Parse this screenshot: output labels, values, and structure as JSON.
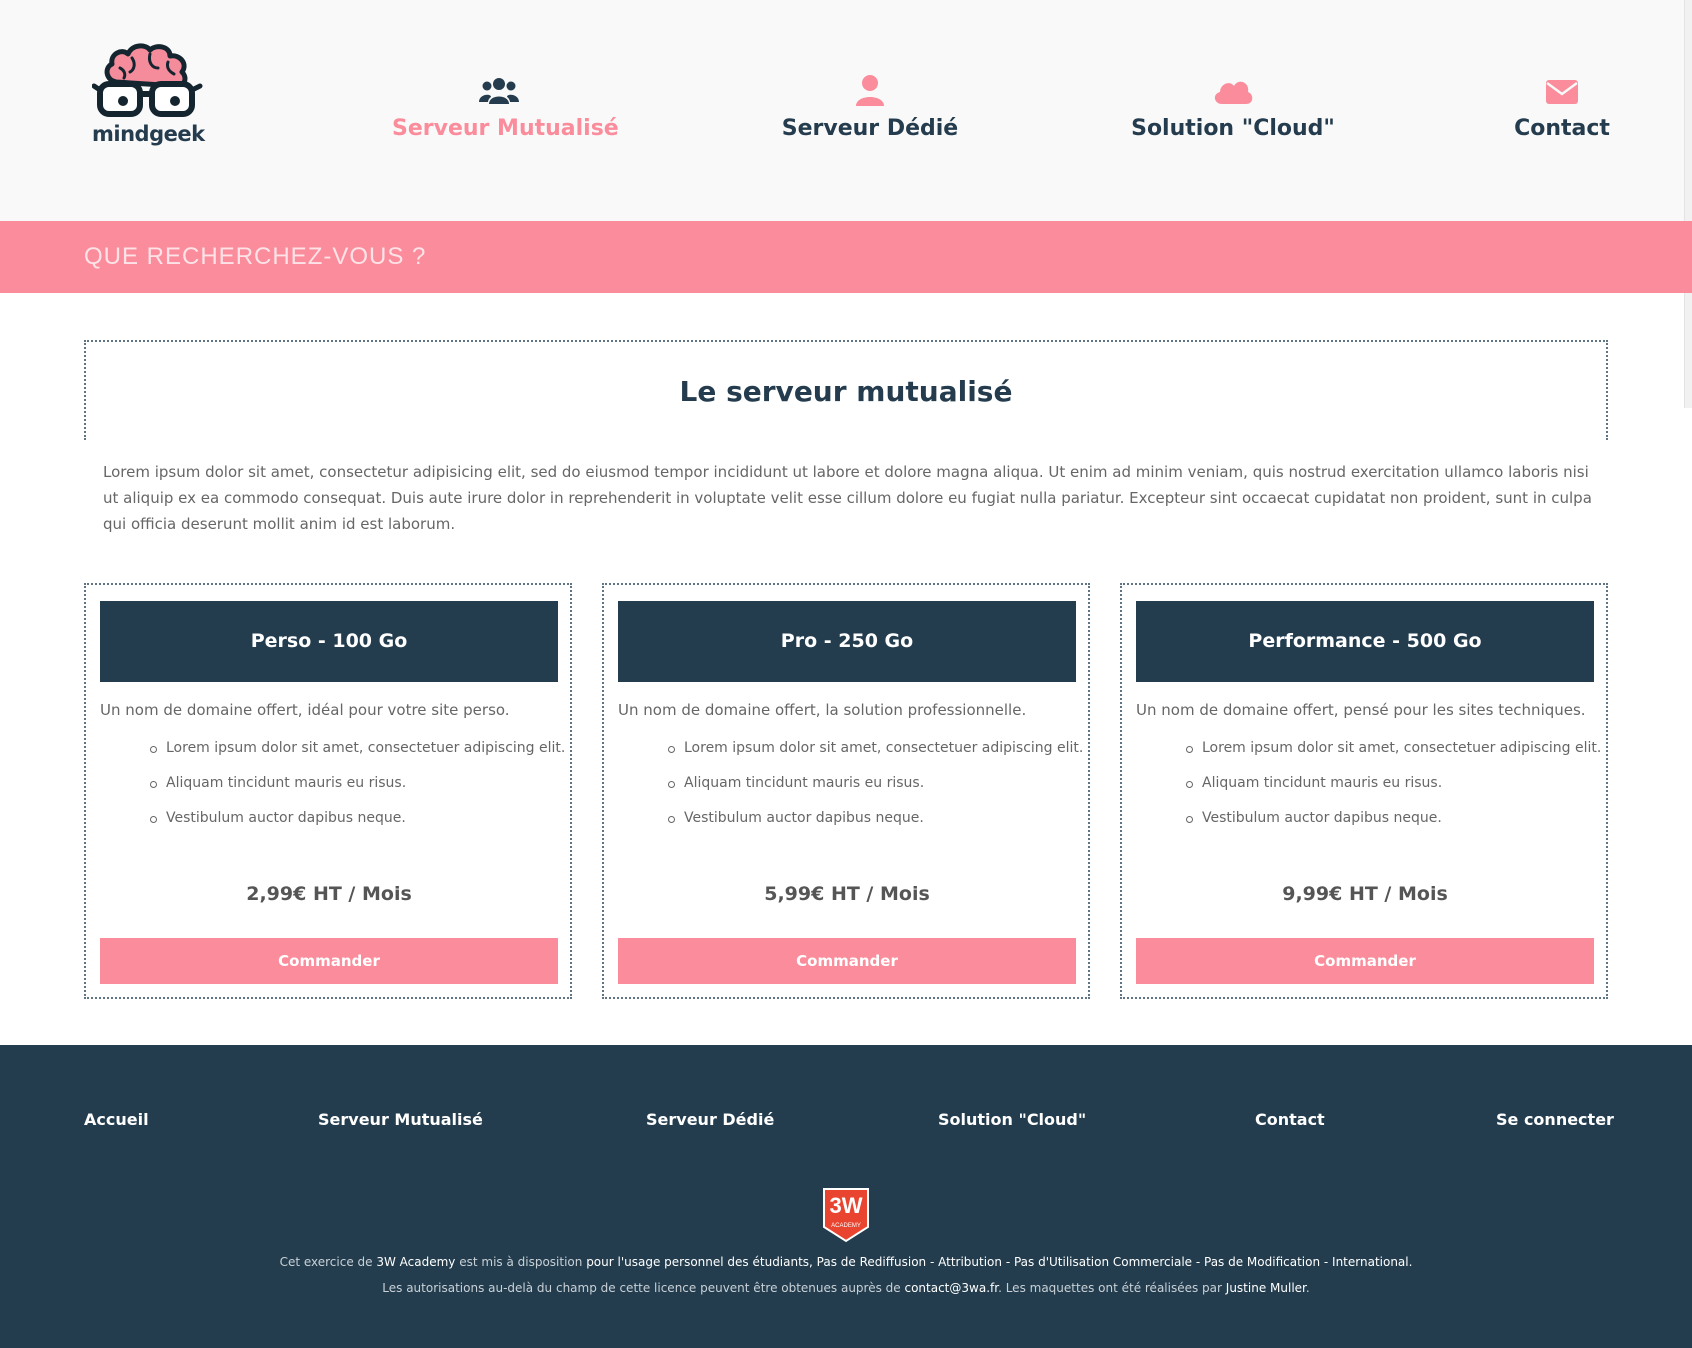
{
  "header": {
    "logo_text": "mindgeek",
    "nav": [
      {
        "label": "Serveur Mutualisé",
        "icon": "users-icon",
        "active": true
      },
      {
        "label": "Serveur Dédié",
        "icon": "user-icon",
        "active": false
      },
      {
        "label": "Solution \"Cloud\"",
        "icon": "cloud-icon",
        "active": false
      },
      {
        "label": "Contact",
        "icon": "envelope-icon",
        "active": false
      }
    ]
  },
  "banner": {
    "text": "QUE RECHERCHEZ-VOUS ?"
  },
  "main": {
    "title": "Le serveur mutualisé",
    "intro": "Lorem ipsum dolor sit amet, consectetur adipisicing elit, sed do eiusmod tempor incididunt ut labore et dolore magna aliqua. Ut enim ad minim veniam, quis nostrud exercitation ullamco laboris nisi ut aliquip ex ea commodo consequat. Duis aute irure dolor in reprehenderit in voluptate velit esse cillum dolore eu fugiat nulla pariatur. Excepteur sint occaecat cupidatat non proident, sunt in culpa qui officia deserunt mollit anim id est laborum."
  },
  "plans": [
    {
      "name": "Perso - 100 Go",
      "description": "Un nom de domaine offert, idéal pour votre site perso.",
      "features": [
        "Lorem ipsum dolor sit amet, consectetuer adipiscing elit.",
        "Aliquam tincidunt mauris eu risus.",
        "Vestibulum auctor dapibus neque."
      ],
      "price": "2,99€ HT / Mois",
      "button": "Commander"
    },
    {
      "name": "Pro - 250 Go",
      "description": "Un nom de domaine offert, la solution professionnelle.",
      "features": [
        "Lorem ipsum dolor sit amet, consectetuer adipiscing elit.",
        "Aliquam tincidunt mauris eu risus.",
        "Vestibulum auctor dapibus neque."
      ],
      "price": "5,99€ HT / Mois",
      "button": "Commander"
    },
    {
      "name": "Performance - 500 Go",
      "description": "Un nom de domaine offert, pensé pour les sites techniques.",
      "features": [
        "Lorem ipsum dolor sit amet, consectetuer adipiscing elit.",
        "Aliquam tincidunt mauris eu risus.",
        "Vestibulum auctor dapibus neque."
      ],
      "price": "9,99€ HT / Mois",
      "button": "Commander"
    }
  ],
  "footer": {
    "links": [
      "Accueil",
      "Serveur Mutualisé",
      "Serveur Dédié",
      "Solution \"Cloud\"",
      "Contact",
      "Se connecter"
    ],
    "badge_text": "3W",
    "badge_sub": "ACADEMY",
    "credits_line1": {
      "p1": "Cet exercice de ",
      "h1": "3W Academy",
      "p2": " est mis à disposition ",
      "h2": "pour l'usage personnel des étudiants, Pas de Rediffusion - Attribution - Pas d'Utilisation Commerciale - Pas de Modification - International."
    },
    "credits_line2": {
      "p1": "Les autorisations au-delà du champ de cette licence peuvent être obtenues auprès de ",
      "h1": "contact@3wa.fr",
      "p2": ". Les maquettes ont été réalisées par ",
      "h2": "Justine Muller",
      "p3": "."
    }
  },
  "colors": {
    "brand_pink": "#fb8c9b",
    "navy": "#233d4e",
    "header_bg": "#f9f9f9"
  }
}
